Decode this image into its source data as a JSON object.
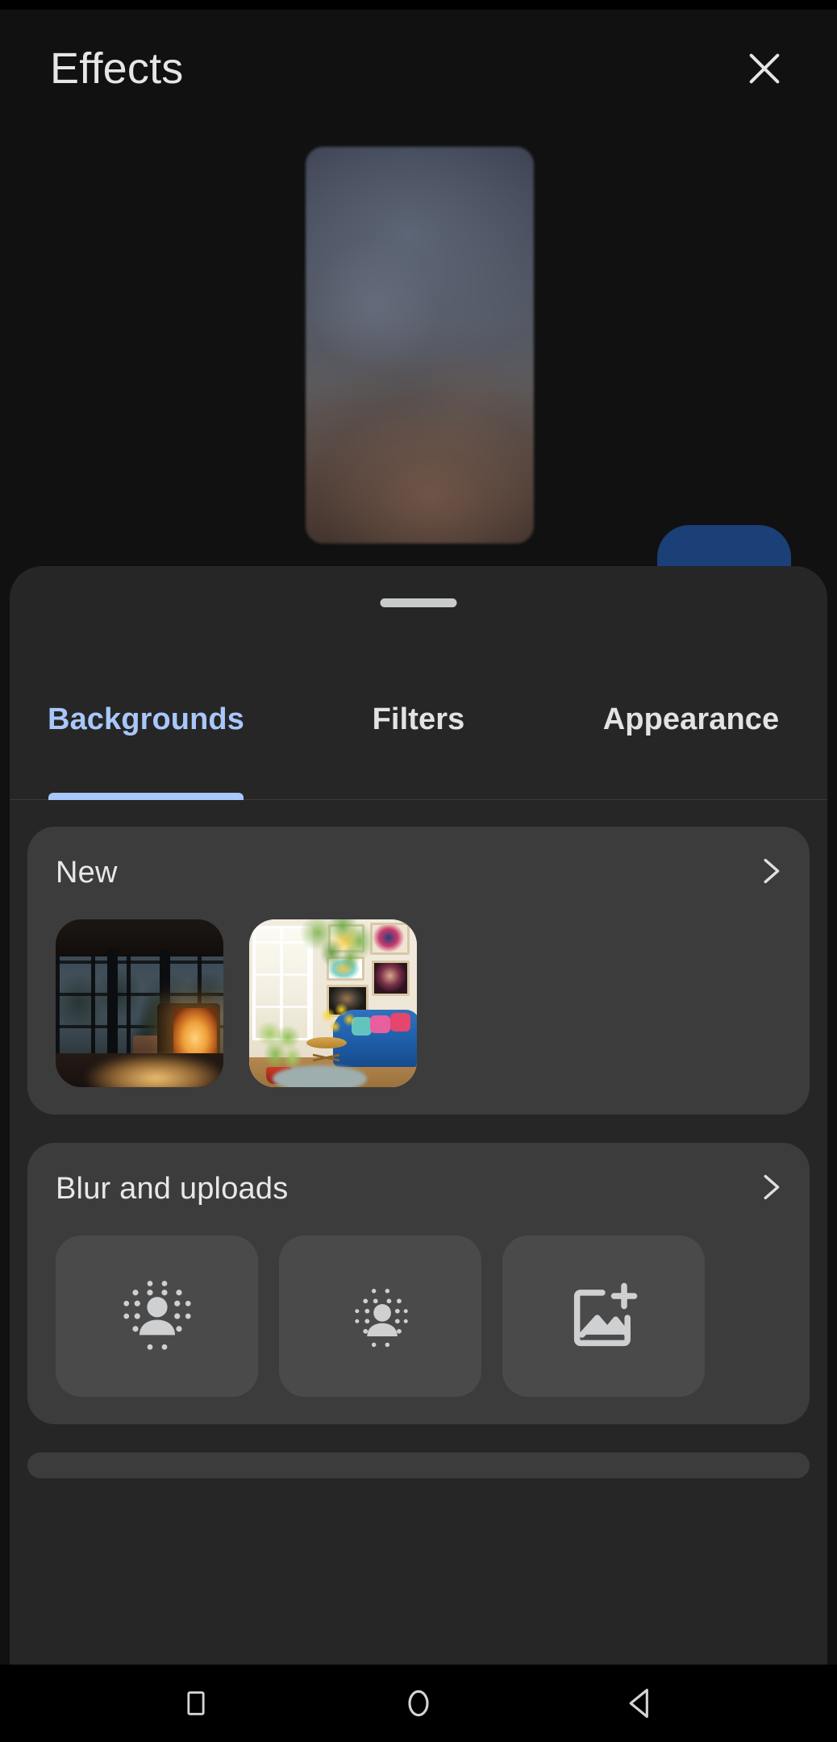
{
  "header": {
    "title": "Effects",
    "close_icon": "close-icon"
  },
  "preview": {
    "description": "blurred self-view video preview",
    "layers_button": {
      "icon": "layers-icon",
      "accent_color": "#1b3f77"
    }
  },
  "sheet": {
    "grabber": "drag-handle",
    "tabs": [
      {
        "label": "Backgrounds",
        "active": true
      },
      {
        "label": "Filters",
        "active": false
      },
      {
        "label": "Appearance",
        "active": false
      }
    ],
    "active_tab_color": "#a8c7fa",
    "groups": [
      {
        "title": "New",
        "expand_icon": "chevron-right-icon",
        "items": [
          {
            "name": "dark-cabin-fireplace-background",
            "kind": "image"
          },
          {
            "name": "bright-living-room-background",
            "kind": "image"
          }
        ]
      },
      {
        "title": "Blur and uploads",
        "expand_icon": "chevron-right-icon",
        "items": [
          {
            "name": "full-blur-option",
            "kind": "blur",
            "icon": "blur-strong-icon"
          },
          {
            "name": "slight-blur-option",
            "kind": "blur",
            "icon": "blur-light-icon"
          },
          {
            "name": "upload-image-option",
            "kind": "upload",
            "icon": "add-photo-icon"
          }
        ]
      }
    ]
  },
  "navbar": {
    "buttons": [
      {
        "name": "recents-button",
        "icon": "square-icon"
      },
      {
        "name": "home-button",
        "icon": "circle-icon"
      },
      {
        "name": "back-button",
        "icon": "triangle-left-icon"
      }
    ]
  }
}
